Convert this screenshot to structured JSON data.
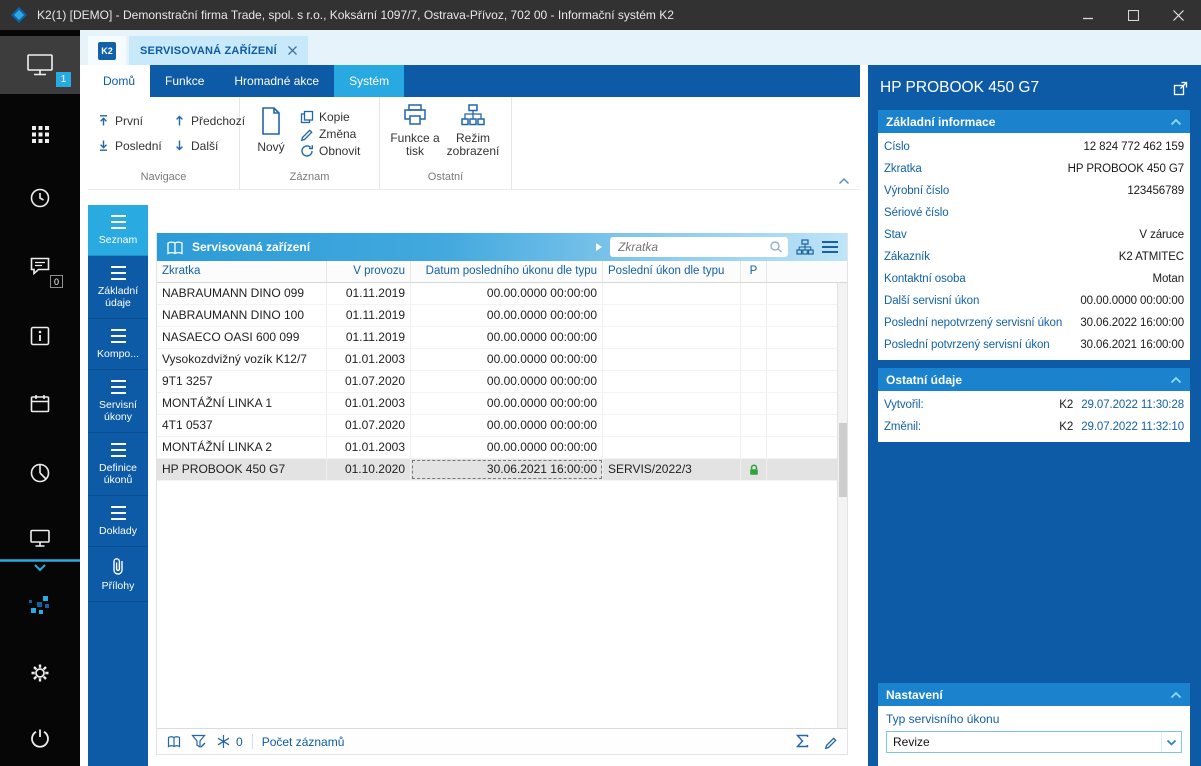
{
  "window": {
    "title": "K2(1) [DEMO] - Demonstrační firma Trade, spol. s r.o., Koksární 1097/7, Ostrava-Přívoz, 702 00 - Informační systém K2"
  },
  "sidebar": {
    "monitor_badge": "1",
    "chat_badge": "0"
  },
  "tabs": {
    "k2_label": "K2",
    "document": "SERVISOVANÁ ZAŘÍZENÍ"
  },
  "ribbon": {
    "tabs": [
      "Domů",
      "Funkce",
      "Hromadné akce",
      "Systém"
    ],
    "nav": {
      "first": "První",
      "previous": "Předchozí",
      "last": "Poslední",
      "next": "Další"
    },
    "record": {
      "new": "Nový",
      "copy": "Kopie",
      "change": "Změna",
      "refresh": "Obnovit"
    },
    "other": {
      "functions_print": "Funkce a tisk",
      "view_mode": "Režim zobrazení"
    },
    "groups": [
      "Navigace",
      "Záznam",
      "Ostatní"
    ]
  },
  "sidenav": {
    "active_index": 0,
    "items": [
      {
        "label": "Seznam",
        "icon": "list"
      },
      {
        "label": "Základní údaje",
        "icon": "list"
      },
      {
        "label": "Kompo...",
        "icon": "list"
      },
      {
        "label": "Servisní úkony",
        "icon": "list"
      },
      {
        "label": "Definice úkonů",
        "icon": "list"
      },
      {
        "label": "Doklady",
        "icon": "list"
      },
      {
        "label": "Přílohy",
        "icon": "paperclip"
      }
    ]
  },
  "table": {
    "title": "Servisovaná zařízení",
    "search_placeholder": "Zkratka",
    "columns": [
      "Zkratka",
      "V provozu",
      "Datum posledního úkonu dle typu",
      "Poslední úkon dle typu",
      "P"
    ],
    "selected_row": 8,
    "rows": [
      {
        "zkratka": "NABRAUMANN DINO 099",
        "v_provozu": "01.11.2019",
        "datum": "00.00.0000 00:00:00",
        "posledni_ukon": "",
        "lock": false
      },
      {
        "zkratka": "NABRAUMANN DINO 100",
        "v_provozu": "01.11.2019",
        "datum": "00.00.0000 00:00:00",
        "posledni_ukon": "",
        "lock": false
      },
      {
        "zkratka": "NASAECO OASI 600 099",
        "v_provozu": "01.11.2019",
        "datum": "00.00.0000 00:00:00",
        "posledni_ukon": "",
        "lock": false
      },
      {
        "zkratka": "Vysokozdvižný vozík K12/7",
        "v_provozu": "01.01.2003",
        "datum": "00.00.0000 00:00:00",
        "posledni_ukon": "",
        "lock": false
      },
      {
        "zkratka": "9T1 3257",
        "v_provozu": "01.07.2020",
        "datum": "00.00.0000 00:00:00",
        "posledni_ukon": "",
        "lock": false
      },
      {
        "zkratka": "MONTÁŽNÍ LINKA 1",
        "v_provozu": "01.01.2003",
        "datum": "00.00.0000 00:00:00",
        "posledni_ukon": "",
        "lock": false
      },
      {
        "zkratka": "4T1 0537",
        "v_provozu": "01.07.2020",
        "datum": "00.00.0000 00:00:00",
        "posledni_ukon": "",
        "lock": false
      },
      {
        "zkratka": "MONTÁŽNÍ LINKA 2",
        "v_provozu": "01.01.2003",
        "datum": "00.00.0000 00:00:00",
        "posledni_ukon": "",
        "lock": false
      },
      {
        "zkratka": "HP PROBOOK 450 G7",
        "v_provozu": "01.10.2020",
        "datum": "30.06.2021 16:00:00",
        "posledni_ukon": "SERVIS/2022/3",
        "lock": true
      }
    ],
    "footer": {
      "filter_count": "0",
      "count_label": "Počet záznamů"
    }
  },
  "detail": {
    "title": "HP PROBOOK 450 G7",
    "basic": {
      "title": "Základní informace",
      "fields": [
        {
          "label": "Číslo",
          "value": "12 824 772 462 159"
        },
        {
          "label": "Zkratka",
          "value": "HP PROBOOK 450 G7"
        },
        {
          "label": "Výrobní číslo",
          "value": "123456789"
        },
        {
          "label": "Sériové číslo",
          "value": ""
        },
        {
          "label": "Stav",
          "value": "V záruce"
        },
        {
          "label": "Zákazník",
          "value": "K2 ATMITEC"
        },
        {
          "label": "Kontaktní osoba",
          "value": "Motan"
        },
        {
          "label": "Další servisní úkon",
          "value": "00.00.0000 00:00:00"
        },
        {
          "label": "Poslední nepotvrzený servisní úkon",
          "value": "30.06.2022 16:00:00"
        },
        {
          "label": "Poslední potvrzený servisní úkon",
          "value": "30.06.2021 16:00:00"
        }
      ]
    },
    "other": {
      "title": "Ostatní údaje",
      "fields": [
        {
          "label": "Vytvořil:",
          "value": "K2",
          "blue": "29.07.2022 11:30:28"
        },
        {
          "label": "Změnil:",
          "value": "K2",
          "blue": "29.07.2022 11:32:10"
        }
      ]
    },
    "settings": {
      "title": "Nastavení",
      "field_label": "Typ servisního úkonu",
      "value": "Revize"
    }
  }
}
